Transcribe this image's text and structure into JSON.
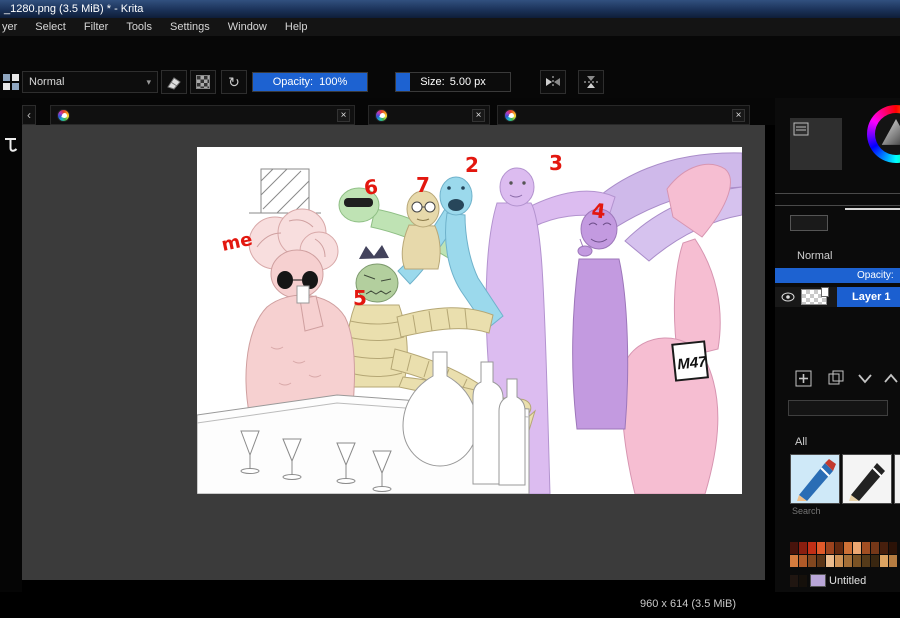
{
  "window": {
    "title": "_1280.png (3.5 MiB) * - Krita"
  },
  "menubar": {
    "items": [
      "yer",
      "Select",
      "Filter",
      "Tools",
      "Settings",
      "Window",
      "Help"
    ]
  },
  "toolbar": {
    "blend_mode": "Normal",
    "opacity_label": "Opacity:",
    "opacity_value": "100%",
    "size_label": "Size:",
    "size_value": "5.00 px"
  },
  "icons": {
    "close": "×",
    "scroll_left": "‹",
    "dropdown_arrow": "▾",
    "reload": "↻",
    "chevron_down": "∨",
    "chevron_up": "∧"
  },
  "right_panel": {
    "blend_mode": "Normal",
    "opacity_label": "Opacity:",
    "layer_name": "Layer 1",
    "tag_filter": "All",
    "search_placeholder": "Search",
    "palette_colors": [
      "#47130b",
      "#8a1e0f",
      "#c22f16",
      "#e05a2a",
      "#9c431d",
      "#63290f",
      "#cf7136",
      "#eda872",
      "#a14e22",
      "#753718",
      "#471f0d",
      "#2b1207",
      "#d57c3e",
      "#b05a28",
      "#82471f",
      "#5c3517",
      "#ecbc8e",
      "#cf9357",
      "#a56f37",
      "#7a5224",
      "#553a19",
      "#392610",
      "#dda462",
      "#b67c41"
    ],
    "palette_extra": [
      "#201611",
      "#15100b"
    ],
    "palette_selected_color": "#b9a6d8",
    "palette_name": "Untitled"
  },
  "statusbar": {
    "dimensions": "960 x 614 (3.5 MiB)"
  },
  "artwork": {
    "me_label": "me",
    "numbers": {
      "n2": "2",
      "n3": "3",
      "n4": "4",
      "n5": "5",
      "n6": "6",
      "n7": "7"
    },
    "signature": "M47"
  },
  "colors": {
    "accent_blue": "#1d62d1",
    "titlebar_top": "#31507f",
    "canvas_bg": "#3b3b3b"
  }
}
